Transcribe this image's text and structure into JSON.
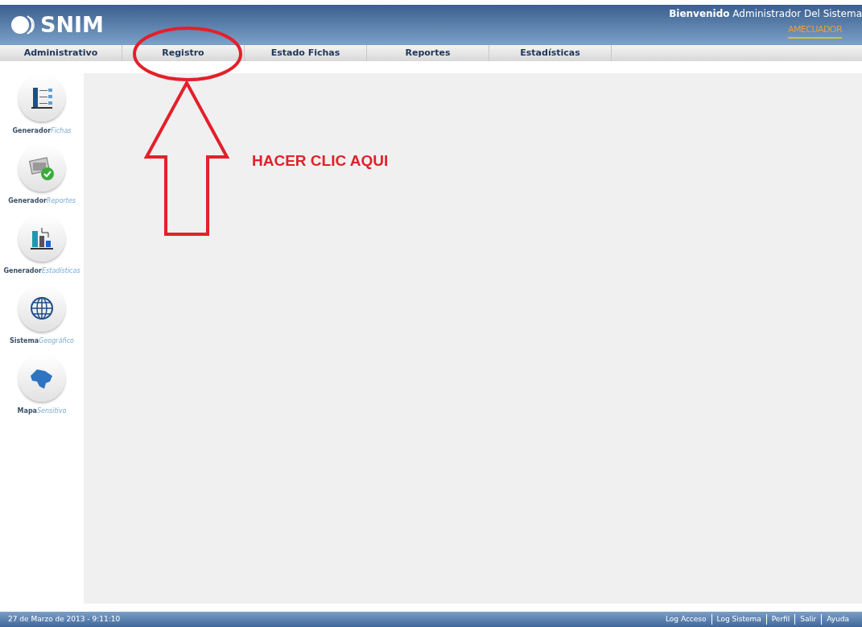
{
  "header": {
    "logo_text": "SNIM",
    "welcome_bold": "Bienvenido",
    "welcome_user": "Administrador Del Sistema",
    "partner_logo": "AMECUADOR"
  },
  "nav": [
    {
      "label": "Administrativo",
      "selected": false
    },
    {
      "label": "Registro",
      "selected": false
    },
    {
      "label": "Estado Fichas",
      "selected": false
    },
    {
      "label": "Reportes",
      "selected": false
    },
    {
      "label": "Estadísticas",
      "selected": false
    }
  ],
  "sidebar": [
    {
      "kind": "fichas",
      "label_main": "Generador",
      "label_sub": "Fichas"
    },
    {
      "kind": "reportes",
      "label_main": "Generador",
      "label_sub": "Reportes"
    },
    {
      "kind": "estadisticas",
      "label_main": "Generador",
      "label_sub": "Estadísticas"
    },
    {
      "kind": "geografico",
      "label_main": "Sistema",
      "label_sub": "Geográfico"
    },
    {
      "kind": "mapa",
      "label_main": "Mapa",
      "label_sub": "Sensitivo"
    }
  ],
  "annotation": {
    "text": "HACER CLIC AQUI"
  },
  "status_bar": {
    "datetime": "27 de Marzo de 2013 - 9:11:10",
    "links": [
      "Log Acceso",
      "Log Sistema",
      "Perfil",
      "Salir",
      "Ayuda"
    ]
  }
}
